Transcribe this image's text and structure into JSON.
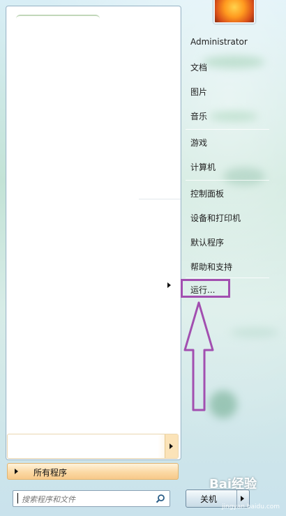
{
  "user": {
    "name": "Administrator"
  },
  "menu": {
    "documents": "文档",
    "pictures": "图片",
    "music": "音乐",
    "games": "游戏",
    "computer": "计算机",
    "control_panel": "控制面板",
    "devices_printers": "设备和打印机",
    "default_programs": "默认程序",
    "help_support": "帮助和支持",
    "run": "运行..."
  },
  "left": {
    "all_programs": "所有程序",
    "search_placeholder": "搜索程序和文件"
  },
  "shutdown": {
    "label": "关机"
  },
  "watermark": {
    "brand": "Bai经验",
    "url": "jingyan.baidu.com"
  },
  "colors": {
    "highlight": "#a24fb0",
    "accent_orange": "#f7c98a"
  },
  "icons": [
    "search-icon",
    "chevron-right-icon",
    "up-arrow-annotation-icon",
    "user-avatar-flower"
  ]
}
